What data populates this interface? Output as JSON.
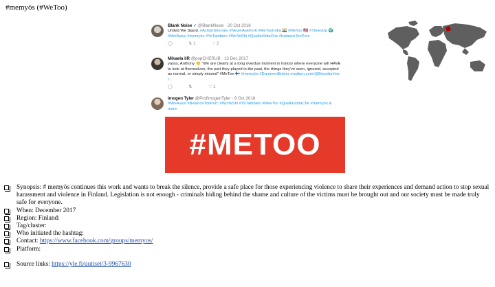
{
  "document": {
    "title": "#memyös (#WeToo)"
  },
  "tweets": [
    {
      "name": "Blank Noise",
      "handle": "@BlankNoise · 20 Oct 2018",
      "text": "United We Stand.",
      "tags": "#ActionSheroes #NeverAskForIt #MeTooIndia 🇮🇳 #MeToo 🇺🇸 #TimesUp 🌍 #MoiAussi #memyös #YoTambien #WoYeShi #QuellaVoltaChe #balanceTonPorc",
      "replies": "",
      "retweets": "1",
      "likes": "2"
    },
    {
      "name": "Mikaela liR",
      "handle": "@popCHERUB · 13 Dec 2017",
      "text": "yasss, Anthony 👏 \"We are clearly at a long overdue moment in history where everyone will HAVE to look at themselves, the part they played in the past, the things they've seen, ignored, accepted as normal, or simply missed\" #MeToo 🇫🇮",
      "tags": "#memyös #DammenBrister medium.com/@Bourdon/on-r...",
      "replies": "",
      "retweets": "",
      "likes": "1"
    },
    {
      "name": "Imogen Tyler",
      "handle": "@ProfImogenTyler · 6 Oct 2018",
      "text": "",
      "tags": "#MoiAussi #BalanceTonPorc #WoYeShi #YoTambien #MeeToo #QuellaVoltaChe #memyös & more",
      "replies": "",
      "retweets": "",
      "likes": ""
    }
  ],
  "banner": {
    "text": "#METOO",
    "color": "#e53a2a"
  },
  "icons": {
    "reply": "reply-icon",
    "retweet": "retweet-icon",
    "like": "heart-icon",
    "map": "world-map-icon"
  },
  "info": {
    "synopsis": "Synopsis: # memyös continues this work and wants to break the silence, provide a safe place for those experiencing violence to share their experiences and demand action to stop sexual harassment and violence in Finland. Legislation is not enough - criminals hiding behind the shame and culture of the victims must be brought out and our society must be made truly safe for everyone.",
    "when": "When: December 2017",
    "region": "Region: Finland:",
    "tag": "Tag/cluster:",
    "initiated": "Who initiated the hashtag:",
    "contact_label": "Contact: ",
    "contact_link": "https://www.facebook.com/groups/memyos/",
    "platform": "Platform:",
    "source_label": "Source links: ",
    "source_link": "https://yle.fi/uutiset/3-9967630"
  }
}
